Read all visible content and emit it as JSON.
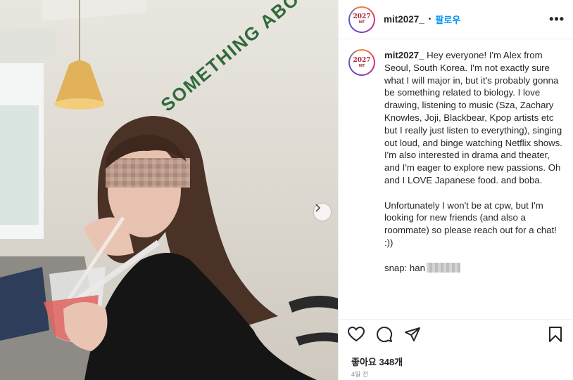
{
  "post": {
    "username": "mit2027_",
    "dot": "•",
    "follow_label": "팔로우",
    "more_label": "•••",
    "avatar": {
      "year": "2027",
      "sub": "MIT"
    },
    "caption": {
      "username": "mit2027_",
      "paragraph1": "Hey everyone! I'm Alex from Seoul, South Korea. I'm not exactly sure what I will major in, but it's probably gonna be something related to biology. I love drawing, listening to music (Sza, Zachary Knowles, Joji, Blackbear, Kpop artists etc but I really just listen to everything), singing out loud, and binge watching Netflix shows. I'm also interested in drama and theater, and I'm eager to explore new passions. Oh and I LOVE Japanese food. and boba.",
      "paragraph2": "Unfortunately I won't be at cpw, but I'm looking for new friends (and also a roommate) so please reach out for a chat! :))",
      "snap_prefix": "snap: han"
    },
    "likes": "좋아요 348개",
    "time_ago": "4일 전"
  },
  "photo": {
    "wall_sign_text": "SOMETHING ABOUT",
    "icons": {
      "carousel_next": "chevron-right-icon",
      "like": "heart-icon",
      "comment": "comment-icon",
      "share": "paper-plane-icon",
      "save": "bookmark-icon"
    }
  },
  "colors": {
    "follow": "#0095f6",
    "text": "#262626",
    "muted": "#8e8e8e",
    "sign": "#2f6b3a"
  }
}
